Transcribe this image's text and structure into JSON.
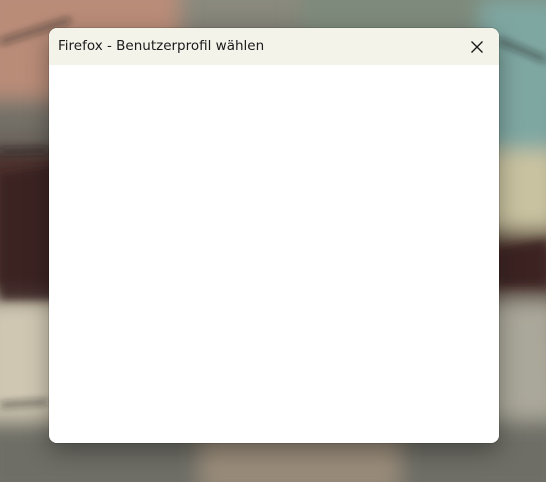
{
  "dialog": {
    "title": "Firefox - Benutzerprofil wählen",
    "close_icon": "close-icon"
  },
  "colors": {
    "titlebar_bg": "#f3f3ea",
    "content_bg": "#ffffff"
  }
}
